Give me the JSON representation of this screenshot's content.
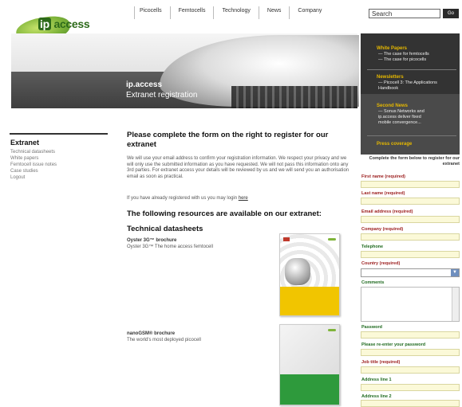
{
  "brand": {
    "logo_prefix": "ip",
    "logo_suffix": "access"
  },
  "nav": {
    "items": [
      "Picocells",
      "Femtocells",
      "Technology",
      "News",
      "Company"
    ]
  },
  "search": {
    "value": "Search",
    "button": "Go"
  },
  "banner": {
    "title": "ip.access",
    "subtitle": "Extranet registration"
  },
  "right_panel": {
    "sections": [
      {
        "heading": "White Papers",
        "lines": [
          "— The case for femtocells",
          "— The case for picocells"
        ]
      },
      {
        "heading": "Newsletters",
        "lines": [
          "— Picocell 3: The Applications",
          "Handbook"
        ]
      },
      {
        "heading": "Second News",
        "lines": [
          "— Sonus Networks and",
          "ip.access deliver fixed",
          "mobile convergence..."
        ]
      },
      {
        "heading": "Press coverage",
        "lines": []
      }
    ]
  },
  "sidebar": {
    "title": "Extranet",
    "links": [
      "Technical datasheets",
      "White papers",
      "Femtocell issue notes",
      "Case studies",
      "Logout"
    ]
  },
  "main": {
    "heading": "Please complete the form on the right to register for our extranet",
    "intro": "We will use your email address to confirm your registration information. We respect your privacy and we will only use the submitted information as you have requested. We will not pass this information onto any 3rd parties. For extranet access your details will be reviewed by us and we will send you an authorisation email as soon as practical.",
    "login_prefix": "If you have already registered with us you may login ",
    "login_link": "here",
    "resources_heading": "The following resources are available on our extranet:",
    "datasheets_heading": "Technical datasheets",
    "resources": [
      {
        "title": "Oyster 3G™ brochure",
        "desc": "Oyster 3G™ The home access femtocell"
      },
      {
        "title": "nanoGSM® brochure",
        "desc": "The world's most deployed picocell"
      }
    ]
  },
  "form": {
    "intro": "Complete the form below to register for our extranet",
    "fields": [
      {
        "label": "First name (required)",
        "required": true
      },
      {
        "label": "Last name (required)",
        "required": true
      },
      {
        "label": "Email address (required)",
        "required": true
      },
      {
        "label": "Company (required)",
        "required": true
      },
      {
        "label": "Telephone",
        "required": false
      },
      {
        "label": "Country (required)",
        "required": true
      },
      {
        "label": "Comments",
        "required": false
      },
      {
        "label": "Password",
        "required": false
      },
      {
        "label": "Please re-enter your password",
        "required": false
      },
      {
        "label": "Job title (required)",
        "required": true
      },
      {
        "label": "Address line 1",
        "required": false
      },
      {
        "label": "Address line 2",
        "required": false
      }
    ]
  },
  "colors": {
    "accent": "#e6b800",
    "required": "#9b1c1c",
    "optional": "#1f6a1f",
    "field_bg": "#fbf9d8"
  }
}
